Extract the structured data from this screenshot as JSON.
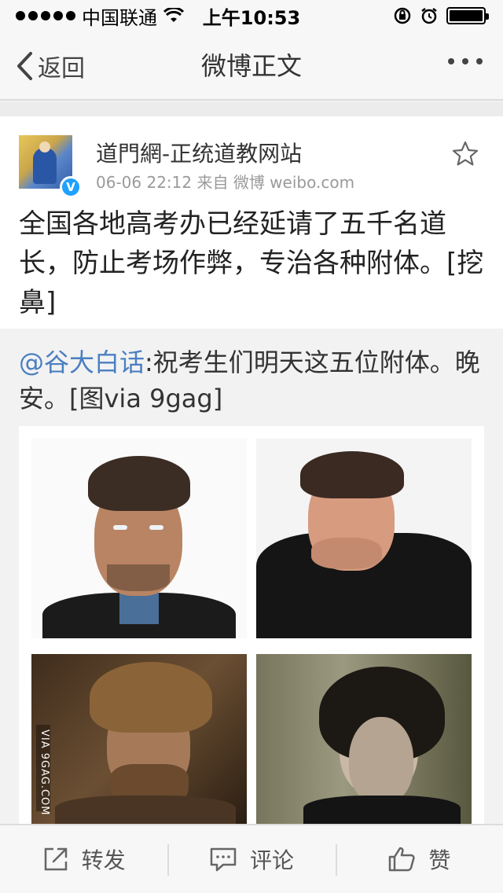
{
  "status_bar": {
    "carrier": "中国联通",
    "time": "上午10:53"
  },
  "nav": {
    "back_label": "返回",
    "title": "微博正文"
  },
  "post": {
    "author": "道門網-正统道教网站",
    "meta": "06-06 22:12  来自 微博 weibo.com",
    "verified_mark": "V",
    "text": "全国各地高考办已经延请了五千名道长，防止考场作弊，专治各种附体。[挖鼻]"
  },
  "retweet": {
    "mention": "@谷大白话",
    "text": ":祝考生们明天这五位附体。晚安。[图via 9gag]",
    "image_watermark": "VIA 9GAG.COM"
  },
  "toolbar": {
    "repost_label": "转发",
    "comment_label": "评论",
    "like_label": "赞"
  },
  "icons": {
    "back": "chevron-left-icon",
    "more": "ellipsis-icon",
    "favorite": "star-icon",
    "repost": "share-arrow-icon",
    "comment": "speech-bubble-icon",
    "like": "thumbs-up-icon"
  },
  "colors": {
    "mention": "#4a7fc1",
    "verified": "#1ea1ff"
  }
}
